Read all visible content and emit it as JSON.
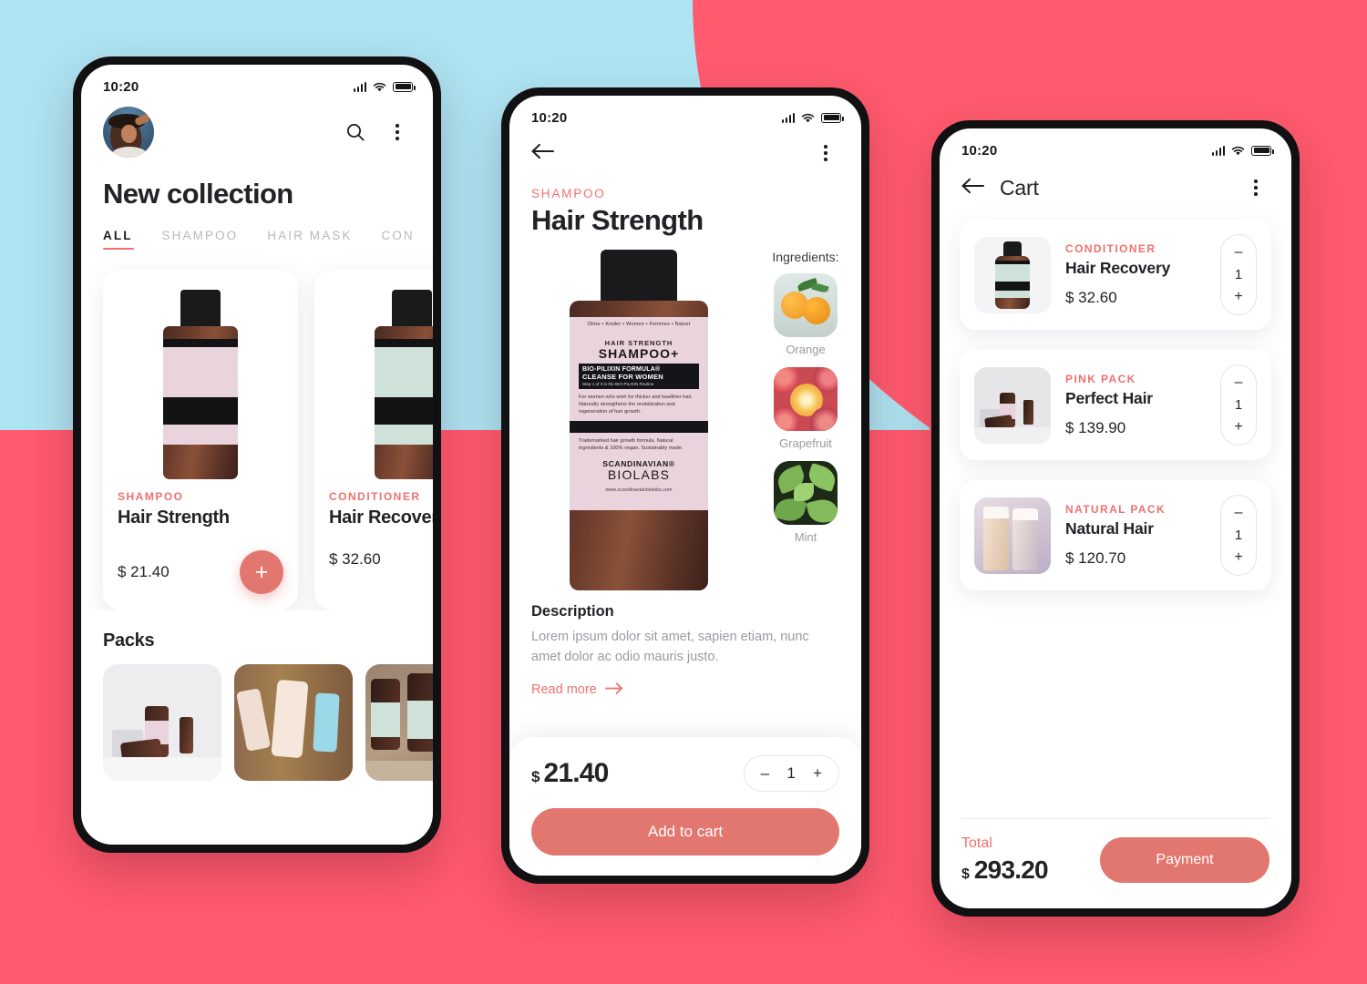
{
  "theme": {
    "accent": "#F0716E",
    "button": "#E2776F",
    "bg_coral": "#FF5A6E",
    "bg_blue": "#AEE3F2",
    "text_dark": "#232327",
    "text_muted": "#9b9ba1"
  },
  "screen1": {
    "status": {
      "time": "10:20"
    },
    "avatar_name": "user-avatar",
    "title": "New collection",
    "tabs": [
      {
        "label": "ALL",
        "active": true
      },
      {
        "label": "SHAMPOO",
        "active": false
      },
      {
        "label": "HAIR MASK",
        "active": false
      },
      {
        "label": "CON",
        "active": false
      }
    ],
    "products": [
      {
        "category": "SHAMPOO",
        "name": "Hair Strength",
        "price": "$ 21.40",
        "add_label": "+"
      },
      {
        "category": "CONDITIONER",
        "name": "Hair Recovery",
        "price": "$ 32.60",
        "add_label": "+"
      }
    ],
    "packs_title": "Packs",
    "packs": [
      {
        "name": "pink-pack-thumbnail"
      },
      {
        "name": "waves-pack-thumbnail"
      },
      {
        "name": "natural-pack-thumbnail"
      }
    ]
  },
  "screen2": {
    "status": {
      "time": "10:20"
    },
    "category": "SHAMPOO",
    "title": "Hair Strength",
    "ingredients_label": "Ingredients:",
    "ingredients": [
      {
        "name": "Orange"
      },
      {
        "name": "Grapefruit"
      },
      {
        "name": "Mint"
      }
    ],
    "bottle_label": {
      "line1": "HAIR STRENGTH",
      "line2": "SHAMPOO+",
      "line3": "BIO-PILIXIN FORMULA®",
      "line4": "CLEANSE FOR WOMEN",
      "line5": "Step 1 of 3 in the BIO-PILIXIN Routine",
      "body1": "For women who wish for thicker and healthier hair. Naturally strengthens the revitalization and regeneration of hair growth.",
      "body2": "Trademarked hair growth formula. Natural ingredients & 100% vegan. Sustainably made.",
      "brand1": "SCANDINAVIAN®",
      "brand2": "BIOLABS",
      "url": "www.scandinavianbiolabs.com",
      "toprow": "Ohne • Kinder • Women • Femmes • Naiset"
    },
    "description_title": "Description",
    "description_text": "Lorem ipsum dolor sit amet, sapien etiam, nunc amet dolor ac odio mauris justo.",
    "read_more": "Read more",
    "price": {
      "currency": "$",
      "amount": "21.40"
    },
    "quantity": "1",
    "minus": "–",
    "plus": "+",
    "cta": "Add to cart"
  },
  "screen3": {
    "status": {
      "time": "10:20"
    },
    "title": "Cart",
    "items": [
      {
        "category": "CONDITIONER",
        "name": "Hair Recovery",
        "price": "$ 32.60",
        "qty": "1"
      },
      {
        "category": "PINK PACK",
        "name": "Perfect Hair",
        "price": "$ 139.90",
        "qty": "1"
      },
      {
        "category": "NATURAL PACK",
        "name": "Natural Hair",
        "price": "$ 120.70",
        "qty": "1"
      }
    ],
    "minus": "–",
    "plus": "+",
    "total_label": "Total",
    "total": {
      "currency": "$",
      "amount": "293.20"
    },
    "payment_label": "Payment"
  }
}
